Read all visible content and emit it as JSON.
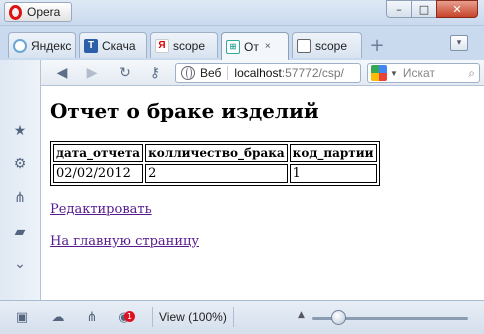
{
  "window": {
    "app_label": "Opera",
    "controls": {
      "minimize": "–",
      "maximize": "□",
      "close": "✕"
    }
  },
  "tabs": [
    {
      "label": "Яндекс",
      "icon": "yandex-download-icon"
    },
    {
      "label": "Скача",
      "icon": "t-site-icon"
    },
    {
      "label": "scope",
      "icon": "yandex-icon",
      "fav_text": "Я"
    },
    {
      "label": "От",
      "icon": "report-page-icon",
      "active": true
    },
    {
      "label": "scope",
      "icon": "document-icon"
    }
  ],
  "tab_close": "×",
  "add_tab": "+",
  "address_bar": {
    "mode_label": "Веб",
    "url_host": "localhost",
    "url_rest": ":57772/csp/",
    "search_placeholder": "Искат"
  },
  "page": {
    "title": "Отчет о браке изделий",
    "table": {
      "headers": [
        "дата_отчета",
        "колличество_брака",
        "код_партии"
      ],
      "rows": [
        [
          "02/02/2012",
          "2",
          "1"
        ]
      ]
    },
    "links": {
      "edit": "Редактировать",
      "home": "На главную страницу"
    }
  },
  "status_bar": {
    "view_label": "View (100%)",
    "notification_count": "1",
    "zoom_percent": 100
  },
  "colors": {
    "link_visited": "#551a8b",
    "chrome_blue": "#c9d9ee",
    "opera_red": "#dd1111"
  }
}
